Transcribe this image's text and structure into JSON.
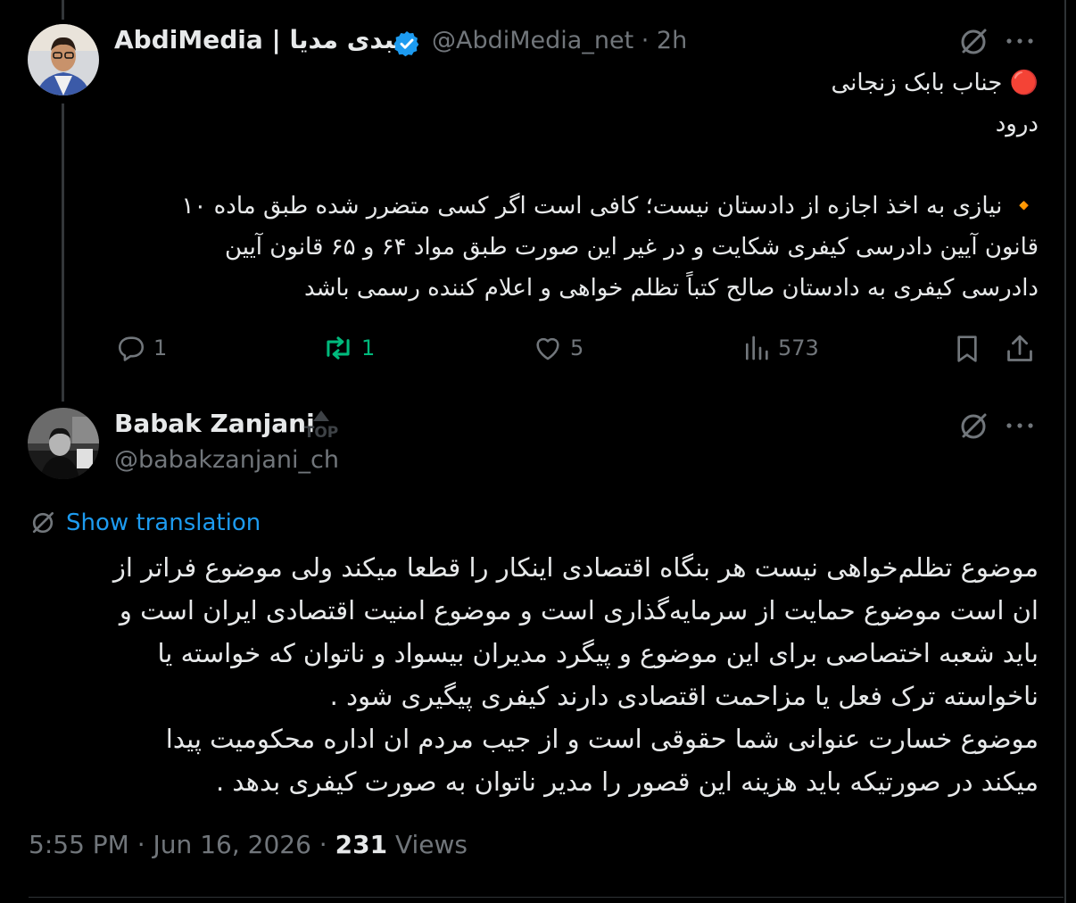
{
  "tweet1": {
    "display_name": "AbdiMedia | عبدی مدیا",
    "handle": "@AbdiMedia_net",
    "time": "· 2h",
    "lines": [
      "🔴 جناب بابک زنجانی",
      "درود",
      "",
      "🔸 نیازی به اخذ اجازه از دادستان نیست؛ کافی است اگر کسی متضرر شده طبق ماده ۱۰",
      "قانون آیین دادرسی کیفری شکایت و در غیر این صورت طبق مواد ۶۴ و ۶۵ قانون آیین",
      "دادرسی کیفری به دادستان صالح کتباً تظلم خواهی و اعلام کننده رسمی باشد"
    ],
    "replies": "1",
    "reposts": "1",
    "likes": "5",
    "views": "573"
  },
  "tweet2": {
    "display_name": "Babak Zanjani",
    "top_badge": "TOP",
    "handle": "@babakzanjani_ch",
    "show_translation": "Show translation",
    "lines": [
      "موضوع تظلم‌خواهی نیست هر بنگاه اقتصادی اینکار را قطعا میکند ولی موضوع فراتر از",
      "ان است موضوع حمایت از سرمایه‌گذاری است و موضوع امنیت اقتصادی ایران است و",
      "باید شعبه اختصاصی برای این موضوع و پیگرد مدیران بیسواد و ناتوان که خواسته یا",
      "ناخواسته ترک فعل یا مزاحمت اقتصادی دارند کیفری پیگیری شود .",
      "موضوع خسارت عنوانی شما حقوقی است و از جیب مردم ان اداره محکومیت پیدا",
      "میکند در صورتیکه باید هزینه این قصور را مدیر ناتوان به صورت کیفری بدهد ."
    ],
    "time": "5:55 PM",
    "date": "Jun 16, 2026",
    "views_count": "231",
    "views_label": "Views"
  },
  "colors": {
    "background": "#000000",
    "text": "#e7e9ea",
    "muted": "#71767b",
    "accent": "#1d9bf0",
    "repost_active": "#00ba7c"
  }
}
